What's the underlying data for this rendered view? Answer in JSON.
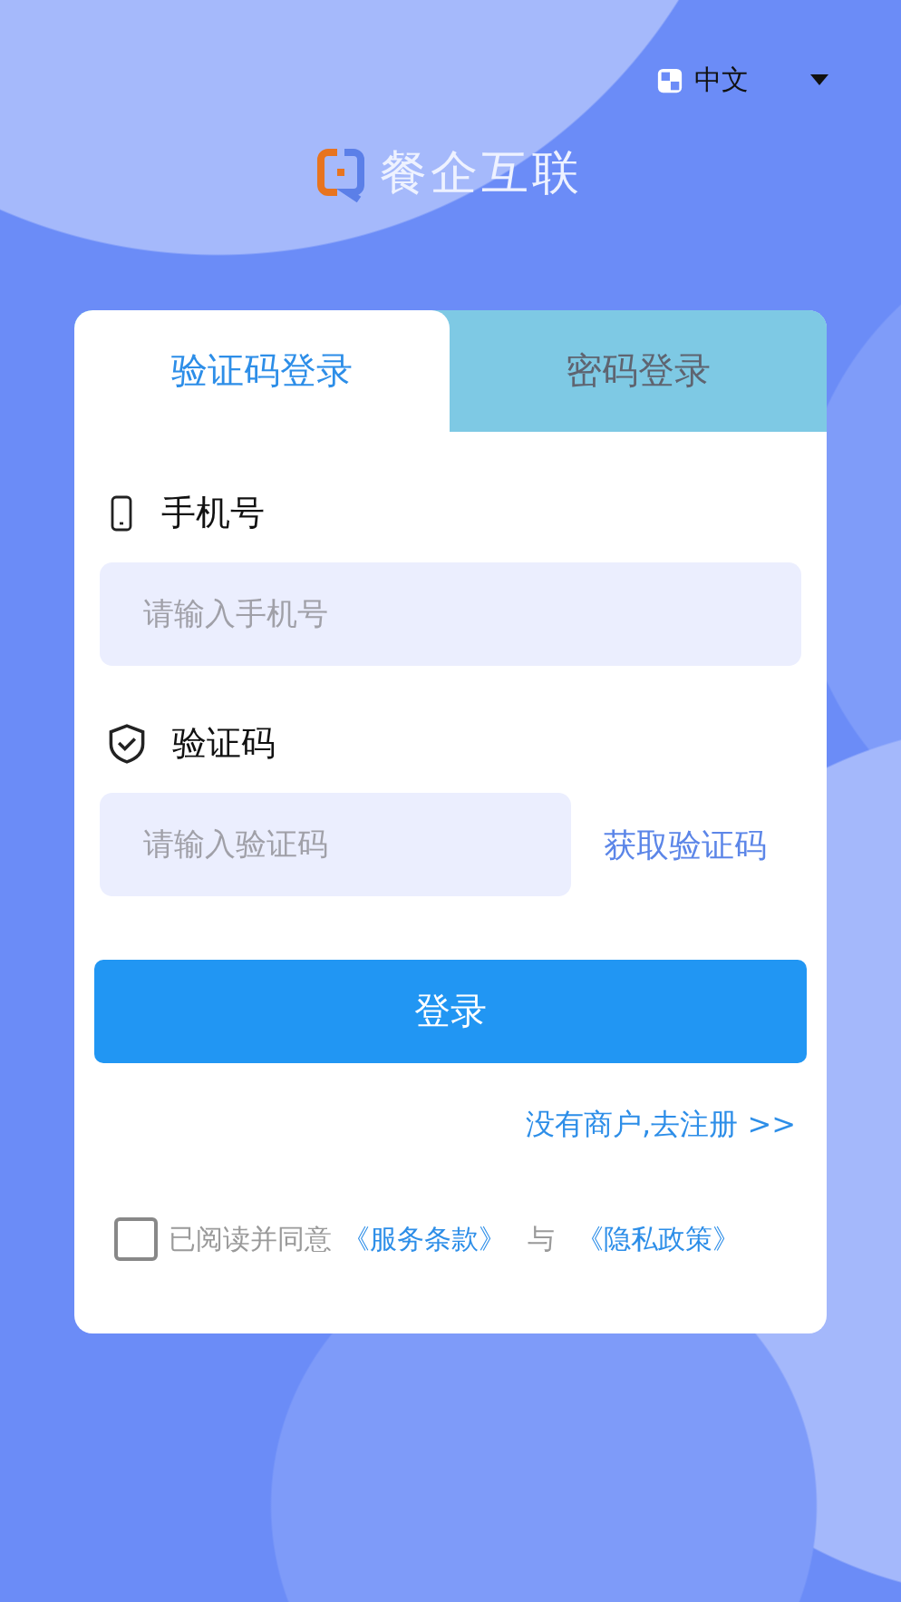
{
  "language": {
    "label": "中文"
  },
  "brand": "餐企互联",
  "tabs": [
    {
      "label": "验证码登录",
      "selected": true
    },
    {
      "label": "密码登录",
      "selected": false
    }
  ],
  "fields": [
    {
      "kind": "phone",
      "label": "手机号",
      "placeholder": "请输入手机号"
    },
    {
      "kind": "code",
      "label": "验证码",
      "placeholder": "请输入验证码",
      "action": "获取验证码"
    }
  ],
  "login_button": "登录",
  "register_link": "没有商户,去注册 >>",
  "agreement": {
    "checked": false,
    "prefix": "已阅读并同意",
    "terms": "《服务条款》",
    "conjunction": "与",
    "privacy": "《隐私政策》"
  }
}
